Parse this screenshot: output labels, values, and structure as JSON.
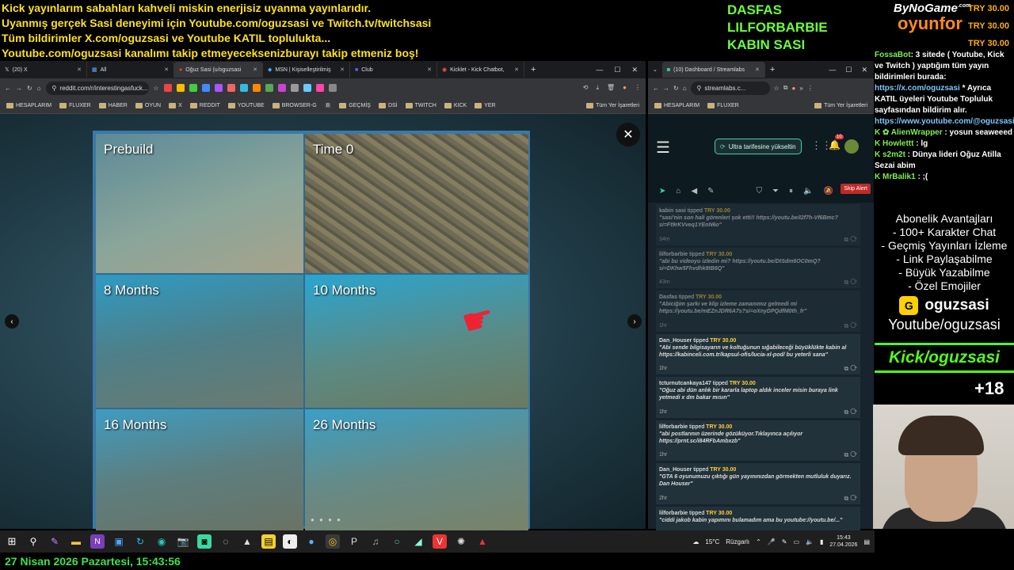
{
  "ticker": [
    "Kick yayınlarım sabahları kahveli miskin enerjisiz uyanma yayınlarıdır.",
    "Uyanmış gerçek Sasi deneyimi için Youtube.com/oguzsasi ve Twitch.tv/twitchsasi",
    "Tüm bildirimler X.com/oguzsasi ve Youtube KATIL toplulukta...",
    "Youtube.com/oguzsasi kanalımı takip etmeyeceksenizburayı takip etmeniz boş!"
  ],
  "top_tippers": [
    "DASFAS",
    "LILFORBARBIE",
    "KABIN SASI"
  ],
  "brand": {
    "line1": "ByNoGame",
    "line2": "oyunfor",
    "suffix": ".com"
  },
  "top_amounts": [
    "TRY 30.00",
    "TRY 30.00",
    "TRY 30.00"
  ],
  "left_browser": {
    "tabs": [
      {
        "label": "(20) X",
        "active": false
      },
      {
        "label": "All",
        "active": false
      },
      {
        "label": "Oğuz Sasi (u/oguzsasi",
        "active": true
      },
      {
        "label": "MSN | Kişiselleştirilmiş",
        "active": false
      },
      {
        "label": "Club",
        "active": false
      },
      {
        "label": "Kicklet - Kick Chatbot,",
        "active": false
      }
    ],
    "url": "reddit.com/r/interestingasfuck...",
    "bookmarks": [
      "HESAPLARIM",
      "FLUXER",
      "HABER",
      "OYUN",
      "X",
      "REDDIT",
      "YOUTUBE",
      "BROWSER-G",
      "B",
      "GEÇMİŞ",
      "DSİ",
      "TWITCH",
      "KICK",
      "YER"
    ],
    "bookmarks_all": "Tüm Yer İşaretleri",
    "image_panels": [
      "Prebuild",
      "Time 0",
      "8 Months",
      "10 Months",
      "16 Months",
      "26 Months"
    ],
    "close_symbol": "✕",
    "prev_symbol": "‹",
    "next_symbol": "›"
  },
  "right_browser": {
    "tab": "(10) Dashboard / Streamlabs",
    "url": "streamlabs.c...",
    "bookmarks": [
      "HESAPLARIM",
      "FLUXER"
    ],
    "bookmarks_all": "Tüm Yer İşaretleri",
    "upgrade_label": "Ultra tarifesine yükseltin",
    "notif_count": "10",
    "skip_label": "Skip Alert",
    "events": [
      {
        "name": "kabin sasi",
        "action": "tipped",
        "amount": "TRY 30.00",
        "message": "\"sasi'nin son hali görenleri şok etti!! https://youtu.be/I2f7h-Vf6Bmc?si=Ft9rKVveq1YEnN6o\"",
        "ago": "34m",
        "dim": true
      },
      {
        "name": "lilforbarbie",
        "action": "tipped",
        "amount": "TRY 30.00",
        "message": "\"abi bu videoyu izledin mi? https://youtu.be/DtSdm6OC0mQ?si=DKhw5Fhvdhk8tB6Q\"",
        "ago": "43m",
        "dim": true
      },
      {
        "name": "Dasfas",
        "action": "tipped",
        "amount": "TRY 30.00",
        "message": "\"Abiciğim şarkı ve klip izleme zamanımız gelmedi mi https://youtu.be/mEZnJDR6A7s?si=oXnyDPQdfM0th_fr\"",
        "ago": "1hr",
        "dim": true
      },
      {
        "name": "Dan_Houser",
        "action": "tipped",
        "amount": "TRY 30.00",
        "message": "\"Abi sende bilgisayarın ve koltuğunun sığabileceği büyüklükte kabin al https://kabinceli.com.tr/kapsul-ofis/lucia-xl-pod/ bu yeterli sana\"",
        "ago": "1hr",
        "dim": false
      },
      {
        "name": "tcturnutcankaya147",
        "action": "tipped",
        "amount": "TRY 30.00",
        "message": "\"Oğuz abi dün anlık bir kararla laptop aldık inceler misin buraya link yetmedi x dm bakar mısın\"",
        "ago": "1hr",
        "dim": false
      },
      {
        "name": "lilforbarbie",
        "action": "tipped",
        "amount": "TRY 30.00",
        "message": "\"abi postlarının üzerinde gözüküyor.Tıklayınca açılıyor https://prnt.sc/i84RFbAmbxzb\"",
        "ago": "1hr",
        "dim": false
      },
      {
        "name": "Dan_Houser",
        "action": "tipped",
        "amount": "TRY 30.00",
        "message": "\"GTA 6 oyunumuzu çıktığı gün yayınınızdan görmekten mutluluk duyarız. Dan Houser\"",
        "ago": "2hr",
        "dim": false
      },
      {
        "name": "lilforbarbie",
        "action": "tipped",
        "amount": "TRY 30.00",
        "message": "\"ciddi jakob kabin yapımını bulamadım ama bu youtube://youtu.be/...\"",
        "ago": "",
        "dim": false
      }
    ]
  },
  "chat": [
    {
      "user": "FossaBot",
      "text": ": 3 sitede ( Youtube, Kick ve Twitch ) yaptığım tüm yayın bildirimleri burada: ",
      "link": "https://x.com/oguzsasi",
      "text2": " * Ayrıca KATIL üyeleri Youtube Topluluk sayfasından bildirim alır. ",
      "link2": "https://www.youtube.com/@oguzsasi/posts"
    },
    {
      "user": "AlienWrapper",
      "text": " : yosun seaweeed"
    },
    {
      "user": "Howlettt",
      "text": " : lg"
    },
    {
      "user": "s2m2t",
      "text": " : Dünya lideri Oğuz Atilla Sezai abim"
    },
    {
      "user": "MrBalik1",
      "text": " : ;("
    }
  ],
  "perks": {
    "title": "Abonelik Avantajları",
    "items": [
      "- 100+ Karakter Chat",
      "- Geçmiş Yayınları İzleme",
      "- Link Paylaşabilme",
      "- Büyük Yazabilme",
      "- Özel Emojiler"
    ]
  },
  "socials": {
    "name": "oguzsasi",
    "youtube": "Youtube/oguzsasi",
    "kick": "Kick/oguzsasi",
    "age": "+18"
  },
  "taskbar": {
    "weather": "15°C",
    "location": "Rüzgarlı",
    "time": "15:43",
    "date": "27.04.2026"
  },
  "datebar": "27 Nisan 2026 Pazartesi, 15:43:56"
}
